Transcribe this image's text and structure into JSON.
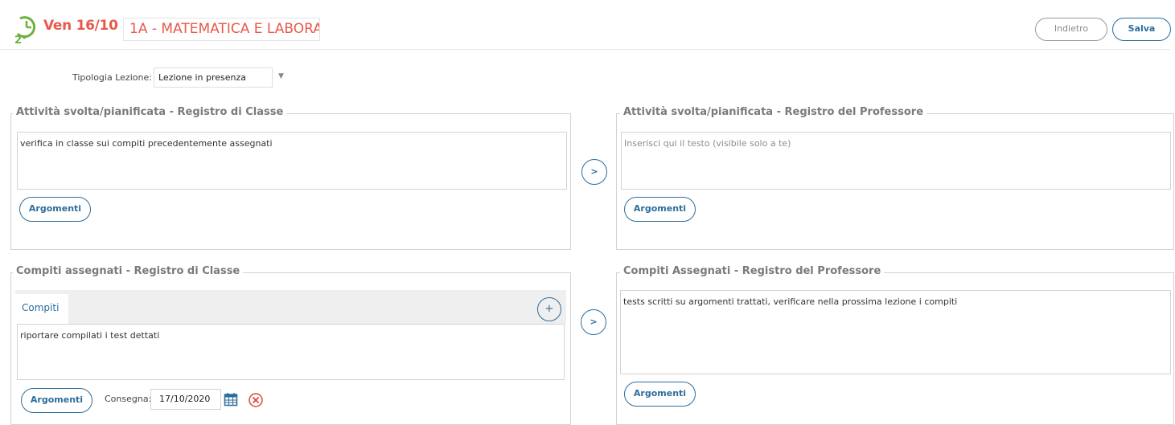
{
  "header": {
    "date": "Ven 16/10",
    "subject": "1A - MATEMATICA E LABORA",
    "back_label": "Indietro",
    "save_label": "Salva",
    "clock_icon": "clock-icon"
  },
  "lesson_type": {
    "label": "Tipologia Lezione:",
    "value": "Lezione in presenza",
    "arrow": "▼"
  },
  "activity_class": {
    "legend": "Attività svolta/pianificata - Registro di Classe",
    "text": "verifica in classe sui compiti precedentemente assegnati",
    "argomenti_label": "Argomenti"
  },
  "activity_prof": {
    "legend": "Attività svolta/pianificata - Registro del Professore",
    "placeholder": "Inserisci qui il testo (visibile solo a te)",
    "argomenti_label": "Argomenti"
  },
  "homework_class": {
    "legend": "Compiti assegnati - Registro di Classe",
    "tab_label": "Compiti",
    "add_label": "+",
    "text": "riportare compilati i test dettati",
    "argomenti_label": "Argomenti",
    "consegna_label": "Consegna:",
    "consegna_value": "17/10/2020"
  },
  "homework_prof": {
    "legend": "Compiti Assegnati - Registro del Professore",
    "text": "tests scritti su argomenti trattati, verificare nella prossima lezione i compiti",
    "argomenti_label": "Argomenti"
  },
  "copy_arrow_label": ">",
  "colors": {
    "accent": "#2c6d9c",
    "title_red": "#e8594b",
    "clock_green": "#6cb33e",
    "clear_red": "#e0463a"
  }
}
